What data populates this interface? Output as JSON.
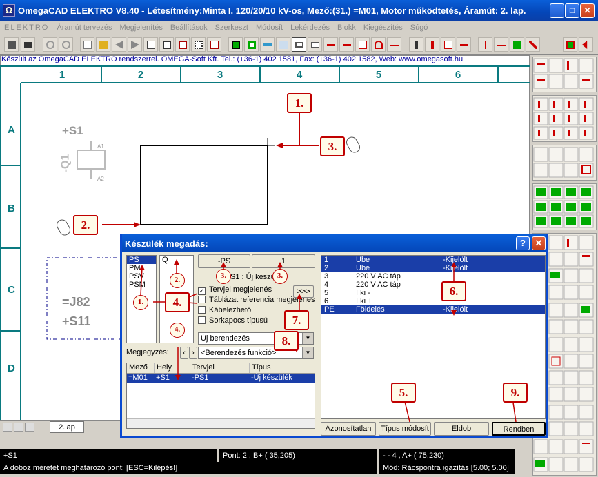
{
  "window": {
    "title": "OmegaCAD ELEKTRO V8.40 - Létesítmény:Minta I. 120/20/10 kV-os, Mező:(31.) =M01, Motor működtetés, Áramút:  2. lap.",
    "icon": "omega-icon",
    "buttons": {
      "minimize": "_",
      "maximize": "□",
      "close": "✕"
    }
  },
  "menu": [
    "ELEKTRO",
    "Áramút tervezés",
    "Megjelenítés",
    "Beállítások",
    "Szerkeszt",
    "Módosít",
    "Lekérdezés",
    "Blokk",
    "Kiegészítés",
    "Súgó"
  ],
  "info_line": "Készült az OmegaCAD ELEKTRO rendszerrel. OMEGA-Soft Kft. Tel.: (+36-1) 402 1581, Fax: (+36-1) 402 1582, Web: www.omegasoft.hu",
  "drawing": {
    "columns": [
      "1",
      "2",
      "3",
      "4",
      "5",
      "6"
    ],
    "rows": [
      "A",
      "B",
      "C",
      "D"
    ],
    "labels": {
      "s1": "+S1",
      "q1": "-Q1",
      "a1": "A1",
      "a2": "A2",
      "j82": "=J82",
      "s11": "+S11"
    }
  },
  "callouts": {
    "c1": "1.",
    "c2": "2.",
    "c3": "3.",
    "c4": "4.",
    "c5": "5.",
    "c6": "6.",
    "c7": "7.",
    "c8": "8.",
    "c9": "9."
  },
  "small_callouts": {
    "s1": "1.",
    "s2": "2.",
    "s3": "3.",
    "s3b": "3.",
    "s4": "4."
  },
  "dialog": {
    "title": "Készülék megadás:",
    "help": "?",
    "prefix_list": [
      "PS",
      "PM",
      "PSV",
      "PSM"
    ],
    "q_value": "Q",
    "btn_ps": "-PS",
    "btn_1": "1",
    "btn_more": ">>>",
    "new_device_label": "S1 : Új készülék",
    "checkboxes": [
      {
        "label": "Tervjel megjelenés",
        "checked": "✓"
      },
      {
        "label": "Táblázat referencia megjelenés",
        "checked": ""
      },
      {
        "label": "Kábelezhető",
        "checked": ""
      },
      {
        "label": "Sorkapocs típusú",
        "checked": ""
      }
    ],
    "type_combo": "Új berendezés",
    "note_label": "Megjegyzés:",
    "func_combo": "<Berendezés funkció>",
    "table": {
      "headers": [
        "Mező",
        "Hely",
        "Tervjel",
        "Típus"
      ],
      "rows": [
        [
          "=M01",
          "+S1",
          "-PS1",
          "-Új készülék"
        ]
      ]
    },
    "contacts": [
      {
        "num": "1",
        "name": "Ube",
        "mark": "-Kijelölt",
        "selected": true
      },
      {
        "num": "2",
        "name": "Ube",
        "mark": "-Kijelölt",
        "selected": true
      },
      {
        "num": "3",
        "name": "220 V AC táp",
        "mark": "",
        "selected": false
      },
      {
        "num": "4",
        "name": "220 V AC táp",
        "mark": "",
        "selected": false
      },
      {
        "num": "5",
        "name": "I ki -",
        "mark": "",
        "selected": false
      },
      {
        "num": "6",
        "name": "I ki +",
        "mark": "",
        "selected": false
      },
      {
        "num": "PE",
        "name": "Földelés",
        "mark": "-Kijelölt",
        "selected": true
      }
    ],
    "buttons": {
      "unidentified": "Azonosítatlan",
      "type_modify": "Típus módosít",
      "remove": "Eldob",
      "ok": "Rendben"
    }
  },
  "tab": {
    "label": "2.lap"
  },
  "status": {
    "left": "+S1",
    "point": "Pont:           2   , B+                ( 35,205)",
    "right": "- - 4   , A+                 ( 75,230)",
    "prompt": "A doboz méretét meghatározó pont: [ESC=Kilépés!]",
    "mode": "Mód: Rácspontra igazítás   [5.00; 5.00]"
  }
}
